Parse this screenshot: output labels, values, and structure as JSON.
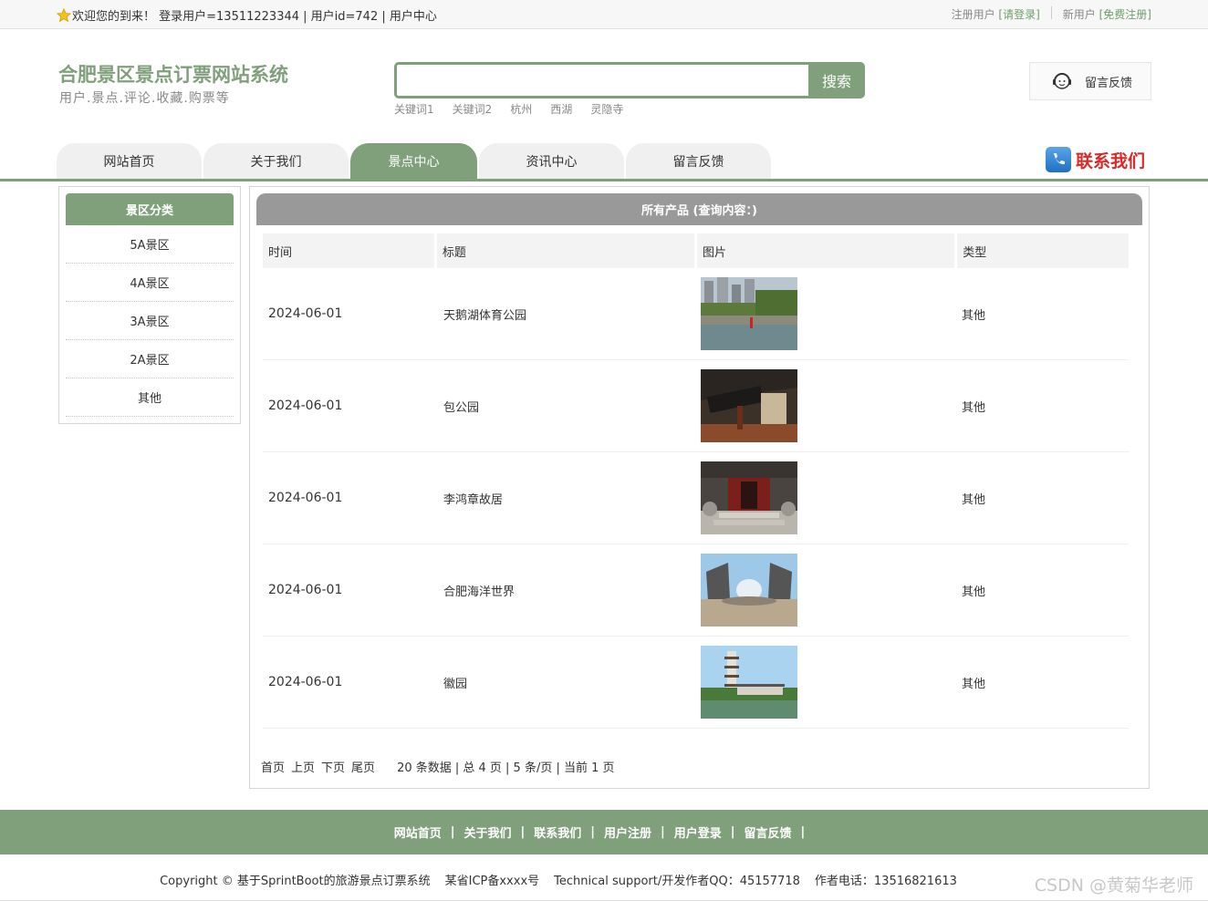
{
  "topbar": {
    "welcome": "欢迎您的到来！ 登录用户=13511223344 | 用户id=742 | 用户中心",
    "register_user_prefix": "注册用户",
    "login_link": "[请登录]",
    "new_user_prefix": "新用户",
    "register_link": "[免费注册]"
  },
  "header": {
    "title": "合肥景区景点订票网站系统",
    "subtitle": "用户.景点.评论.收藏.购票等",
    "search_button": "搜索",
    "search_value": "",
    "hot_keywords": [
      "关键词1",
      "关键词2",
      "杭州",
      "西湖",
      "灵隐寺"
    ],
    "feedback_label": "留言反馈"
  },
  "nav": {
    "tabs": [
      "网站首页",
      "关于我们",
      "景点中心",
      "资讯中心",
      "留言反馈"
    ],
    "active_index": 2,
    "contact_label": "联系我们"
  },
  "sidebar": {
    "title": "景区分类",
    "items": [
      "5A景区",
      "4A景区",
      "3A景区",
      "2A景区",
      "其他"
    ]
  },
  "main": {
    "title": "所有产品 (查询内容：)",
    "columns": [
      "时间",
      "标题",
      "图片",
      "类型"
    ],
    "rows": [
      {
        "date": "2024-06-01",
        "title": "天鹅湖体育公园",
        "type": "其他",
        "image": "lake-park-photo"
      },
      {
        "date": "2024-06-01",
        "title": "包公园",
        "type": "其他",
        "image": "temple-gate-photo"
      },
      {
        "date": "2024-06-01",
        "title": "李鸿章故居",
        "type": "其他",
        "image": "residence-gate-photo"
      },
      {
        "date": "2024-06-01",
        "title": "合肥海洋世界",
        "type": "其他",
        "image": "ocean-world-photo"
      },
      {
        "date": "2024-06-01",
        "title": "徽园",
        "type": "其他",
        "image": "pagoda-garden-photo"
      }
    ],
    "pager": {
      "first": "首页",
      "prev": "上页",
      "next": "下页",
      "last": "尾页",
      "summary": "20 条数据 | 总 4 页 | 5 条/页 | 当前 1 页"
    }
  },
  "footer": {
    "links": [
      "网站首页",
      "关于我们",
      "联系我们",
      "用户注册",
      "用户登录",
      "留言反馈"
    ],
    "copyright": "Copyright © 基于SprintBoot的旅游景点订票系统",
    "icp": "某省ICP备xxxx号",
    "support": "Technical support/开发作者QQ：45157718",
    "phone": "作者电话：13516821613",
    "watermark": "CSDN @黄菊华老师"
  },
  "colors": {
    "accent": "#7fa07b",
    "header_gray": "#999999",
    "contact_red": "#d42a2a"
  }
}
